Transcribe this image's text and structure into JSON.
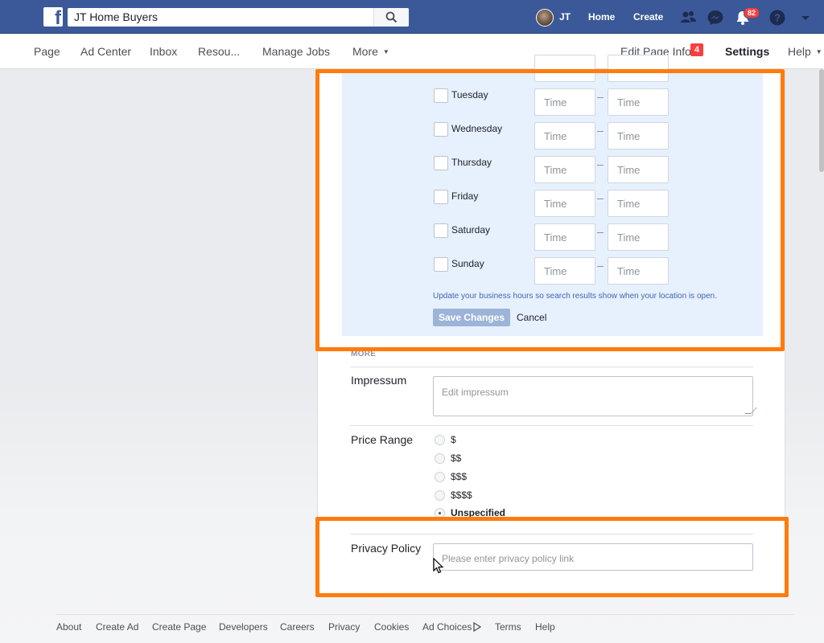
{
  "topbar": {
    "logo_letter": "f",
    "search_value": "JT Home Buyers",
    "user_name": "JT",
    "home_label": "Home",
    "create_label": "Create",
    "notifications_count": "82",
    "colors": {
      "bar": "#3b5998",
      "accent": "#ff7c0c"
    }
  },
  "pagenav": {
    "items": [
      "Page",
      "Ad Center",
      "Inbox",
      "Resou...",
      "Manage Jobs",
      "More"
    ],
    "edit_page_info": "Edit Page Info",
    "edit_badge": "4",
    "settings": "Settings",
    "help": "Help"
  },
  "hours": {
    "days": [
      "Tuesday",
      "Wednesday",
      "Thursday",
      "Friday",
      "Saturday",
      "Sunday"
    ],
    "time_placeholder": "Time",
    "hint": "Update your business hours so search results show when your location is open.",
    "save_label": "Save Changes",
    "cancel_label": "Cancel"
  },
  "more": {
    "section_label": "MORE",
    "impressum_label": "Impressum",
    "impressum_placeholder": "Edit impressum",
    "price_range_label": "Price Range",
    "price_options": [
      "$",
      "$$",
      "$$$",
      "$$$$",
      "Unspecified"
    ],
    "price_selected": "Unspecified",
    "privacy_label": "Privacy Policy",
    "privacy_placeholder": "Please enter privacy policy link"
  },
  "footer": {
    "links": [
      "About",
      "Create Ad",
      "Create Page",
      "Developers",
      "Careers",
      "Privacy",
      "Cookies",
      "Ad Choices",
      "Terms",
      "Help"
    ]
  }
}
